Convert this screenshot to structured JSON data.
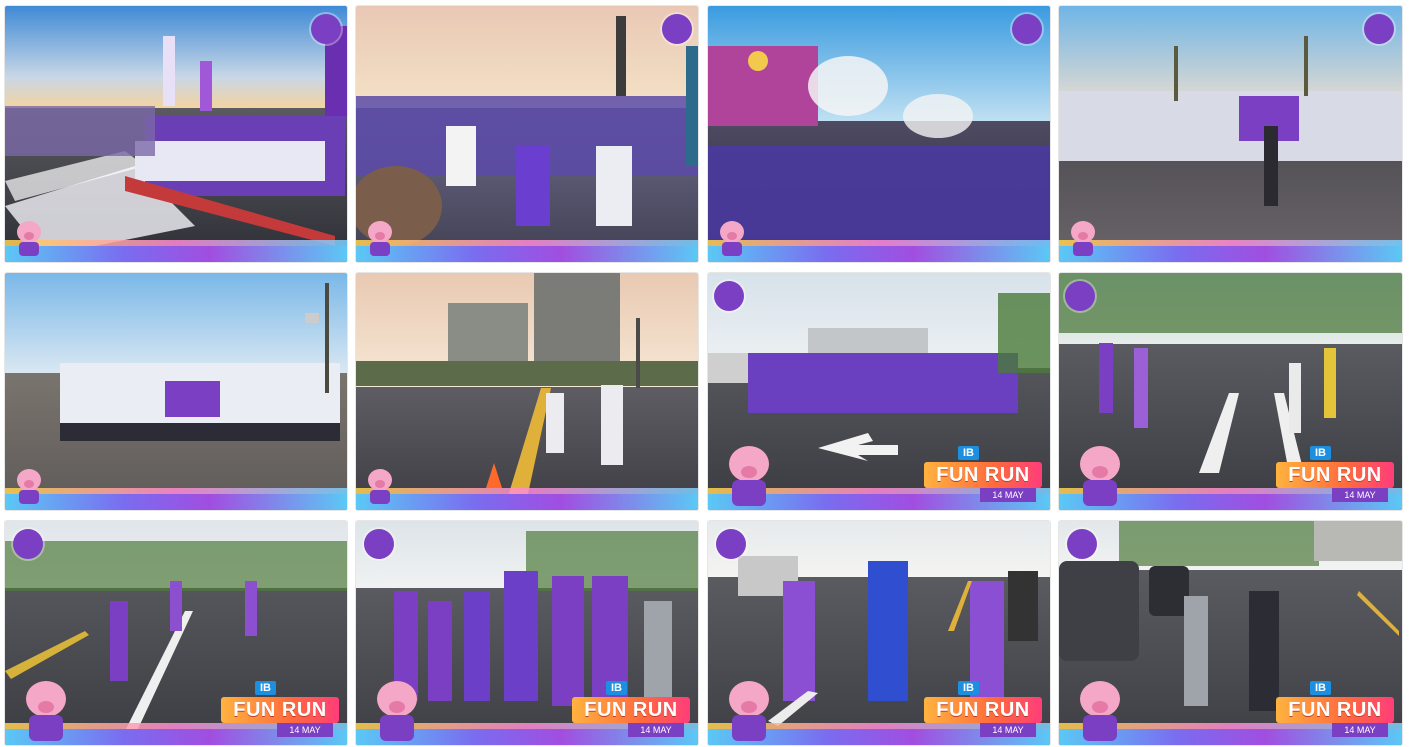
{
  "photos": [
    {
      "id": "p1",
      "scene": "start-line-crowd"
    },
    {
      "id": "p2",
      "scene": "runners-start-backs"
    },
    {
      "id": "p3",
      "scene": "stage-smoke-crowd"
    },
    {
      "id": "p4",
      "scene": "runner-with-flag"
    },
    {
      "id": "p5",
      "scene": "group-photo-banner"
    },
    {
      "id": "p6",
      "scene": "road-towers-runners"
    },
    {
      "id": "p7",
      "scene": "group-photo-road-arrow"
    },
    {
      "id": "p8",
      "scene": "road-runners-purple"
    },
    {
      "id": "p9",
      "scene": "road-runners-purple-far"
    },
    {
      "id": "p10",
      "scene": "group-walkers-front"
    },
    {
      "id": "p11",
      "scene": "three-runners-crosswalk"
    },
    {
      "id": "p12",
      "scene": "walkers-by-suv"
    }
  ],
  "overlay": {
    "badge": "IB",
    "title": "FUN RUN",
    "date": "14 MAY"
  },
  "colors": {
    "brand_purple": "#7b3fc4",
    "sky_blue": "#8ec9ea",
    "road_gray": "#4d4f55",
    "accent_orange": "#ff6a3d"
  }
}
